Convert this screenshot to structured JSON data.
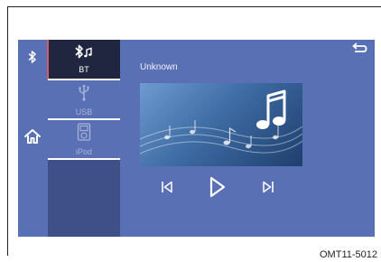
{
  "sources": {
    "bt_label": "BT",
    "usb_label": "USB",
    "ipod_label": "iPod"
  },
  "player": {
    "track_title": "Unknown"
  },
  "icons": {
    "rail": [
      "bluetooth-icon",
      "home-icon"
    ],
    "sources": [
      "bluetooth-audio-icon",
      "usb-icon",
      "ipod-icon"
    ],
    "player": [
      "back-icon",
      "previous-track-icon",
      "play-icon",
      "next-track-icon"
    ]
  },
  "colors": {
    "screen_blue": "#5a70b4",
    "selected_source": "#20263f",
    "source_column": "#3f4f88",
    "selection_edge": "#d25a6c"
  },
  "caption": "OMT11-5012"
}
